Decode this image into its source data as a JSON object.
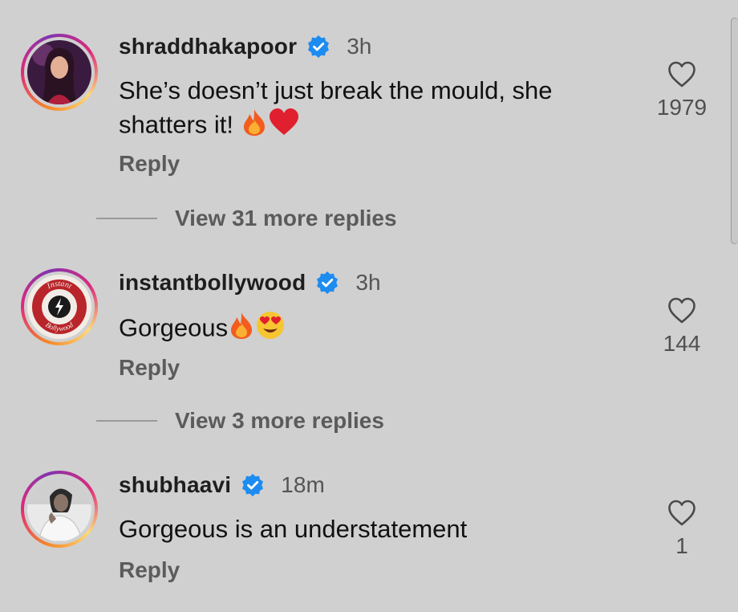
{
  "comments": [
    {
      "username": "shraddhakapoor",
      "time": "3h",
      "text": "She’s doesn’t just break the mould, she shatters it! ",
      "emoji": [
        "fire-emoji",
        "red-heart-emoji"
      ],
      "reply_label": "Reply",
      "likes": "1979",
      "view_replies": "View 31 more replies"
    },
    {
      "username": "instantbollywood",
      "time": "3h",
      "text": "Gorgeous",
      "emoji": [
        "fire-emoji",
        "heart-eyes-emoji"
      ],
      "reply_label": "Reply",
      "likes": "144",
      "view_replies": "View 3 more replies",
      "avatar_logo_text_top": "Instant",
      "avatar_logo_text_bottom": "Bollywood"
    },
    {
      "username": "shubhaavi",
      "time": "18m",
      "text": "Gorgeous is an understatement",
      "reply_label": "Reply",
      "likes": "1"
    }
  ],
  "colors": {
    "background": "#d0d0d0",
    "verified_badge": "#1d8cf0",
    "ring_gradient": [
      "#f58529",
      "#dd2a7b",
      "#8134af"
    ]
  },
  "icons": [
    "verified-badge-icon",
    "heart-outline-icon",
    "fire-emoji",
    "red-heart-emoji",
    "heart-eyes-emoji"
  ]
}
